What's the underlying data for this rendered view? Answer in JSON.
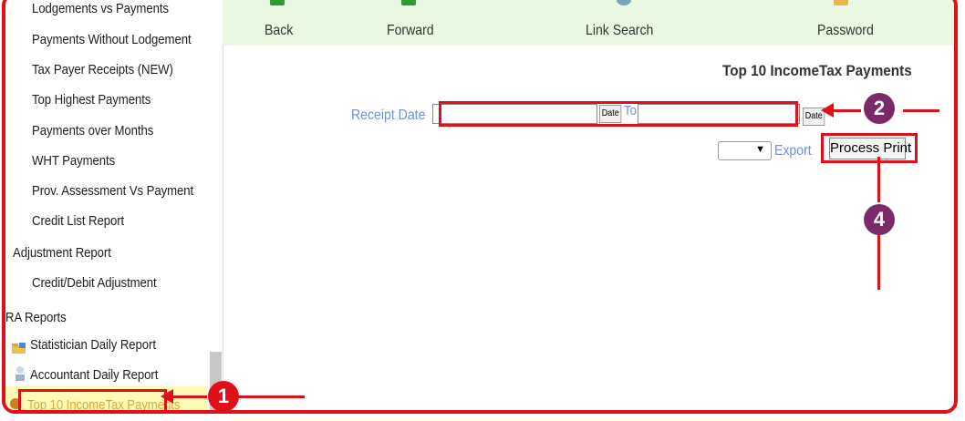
{
  "sidebar": {
    "items": [
      {
        "label": "Lodgements vs Payments"
      },
      {
        "label": "Payments Without Lodgement"
      },
      {
        "label": "Tax Payer Receipts (NEW)"
      },
      {
        "label": "Top Highest Payments"
      },
      {
        "label": "Payments over Months"
      },
      {
        "label": "WHT Payments"
      },
      {
        "label": "Prov. Assessment Vs Payment"
      },
      {
        "label": "Credit List Report"
      },
      {
        "label": "Adjustment Report"
      },
      {
        "label": "Credit/Debit Adjustment"
      },
      {
        "label": "RA Reports"
      },
      {
        "label": "Statistician Daily Report"
      },
      {
        "label": "Accountant Daily Report"
      },
      {
        "label": "Top 10 IncomeTax Payments"
      }
    ]
  },
  "toolbar": {
    "back": "Back",
    "forward": "Forward",
    "link_search": "Link Search",
    "password": "Password"
  },
  "main": {
    "title": "Top 10 IncomeTax Payments",
    "receipt_date_label": "Receipt Date",
    "date_button": "Date",
    "to_label": "To",
    "export_label": "Export",
    "process_print": "Process Print",
    "export_select_value": ""
  },
  "annotations": {
    "m1": "1",
    "m2": "2",
    "m4": "4"
  },
  "colors": {
    "annotation_red": "#e0101a",
    "toolbar_green": "#eaf7e3",
    "label_blue": "#6f8fe0",
    "selected_yellow": "#fffbb5"
  }
}
